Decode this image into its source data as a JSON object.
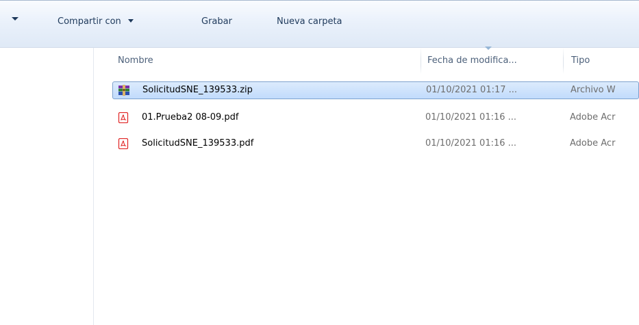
{
  "toolbar": {
    "share_label": "Compartir con",
    "burn_label": "Grabar",
    "new_folder_label": "Nueva carpeta"
  },
  "columns": {
    "name": "Nombre",
    "date": "Fecha de modifica...",
    "type": "Tipo"
  },
  "files": [
    {
      "name": "SolicitudSNE_139533.zip",
      "date": "01/10/2021 01:17 ...",
      "type": "Archivo W",
      "icon": "winrar-archive-icon",
      "selected": true
    },
    {
      "name": "01.Prueba2 08-09.pdf",
      "date": "01/10/2021 01:16 ...",
      "type": "Adobe Acr",
      "icon": "pdf-icon",
      "selected": false
    },
    {
      "name": "SolicitudSNE_139533.pdf",
      "date": "01/10/2021 01:16 ...",
      "type": "Adobe Acr",
      "icon": "pdf-icon",
      "selected": false
    }
  ],
  "colors": {
    "selection_border": "#7da2ce",
    "selection_fill": "#c1dbfc",
    "toolbar_text": "#1e395b",
    "pdf_red": "#e02323"
  }
}
